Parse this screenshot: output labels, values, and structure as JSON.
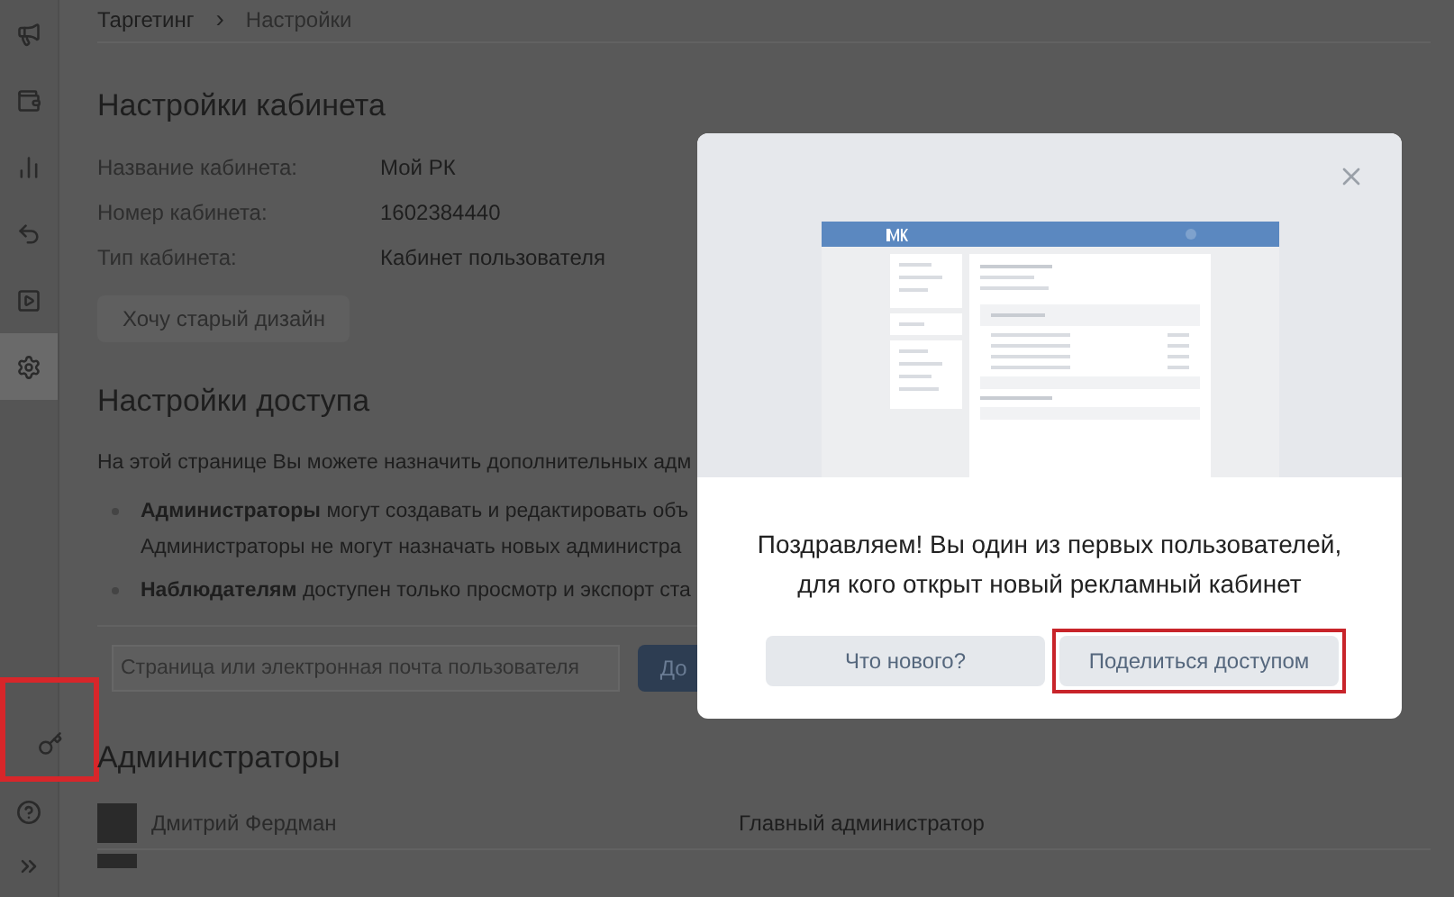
{
  "sidebar": {
    "items": [
      {
        "kind": "megaphone",
        "selected": false
      },
      {
        "kind": "wallet",
        "selected": false
      },
      {
        "kind": "chart",
        "selected": false
      },
      {
        "kind": "undo",
        "selected": false
      },
      {
        "kind": "video",
        "selected": false
      },
      {
        "kind": "settings",
        "selected": true
      }
    ],
    "bottom_items": [
      {
        "kind": "key",
        "highlighted": true
      },
      {
        "kind": "help",
        "highlighted": false
      },
      {
        "kind": "expand",
        "highlighted": false
      }
    ]
  },
  "breadcrumbs": {
    "separator": "›",
    "items": [
      "Таргетинг",
      "Настройки"
    ]
  },
  "account_settings": {
    "title": "Настройки кабинета",
    "fields": [
      {
        "label": "Название кабинета:",
        "value": "Мой РК"
      },
      {
        "label": "Номер кабинета:",
        "value": "1602384440"
      },
      {
        "label": "Тип кабинета:",
        "value": "Кабинет пользователя"
      }
    ],
    "old_design_button": "Хочу старый дизайн"
  },
  "access_settings": {
    "title": "Настройки доступа",
    "intro": "На этой странице Вы можете назначить дополнительных адм",
    "bullets": [
      {
        "lines": [
          "**Администраторы** могут создавать и редактировать объ",
          "Администраторы не могут назначать новых администра"
        ]
      },
      {
        "lines": [
          "**Наблюдателям** доступен только просмотр и экспорт ста"
        ]
      }
    ],
    "input": {
      "placeholder": "Страница или электронная почта пользователя"
    },
    "add_button": "До"
  },
  "administrators": {
    "title": "Администраторы",
    "rows": [
      {
        "name": "Дмитрий Фердман",
        "role": "Главный администратор"
      }
    ]
  },
  "modal": {
    "message": "Поздравляем! Вы один из первых пользователей, для кого открыт новый рекламный кабинет",
    "buttons": [
      {
        "label": "Что нового?",
        "highlighted": false
      },
      {
        "label": "Поделиться доступом",
        "highlighted": true
      }
    ]
  }
}
